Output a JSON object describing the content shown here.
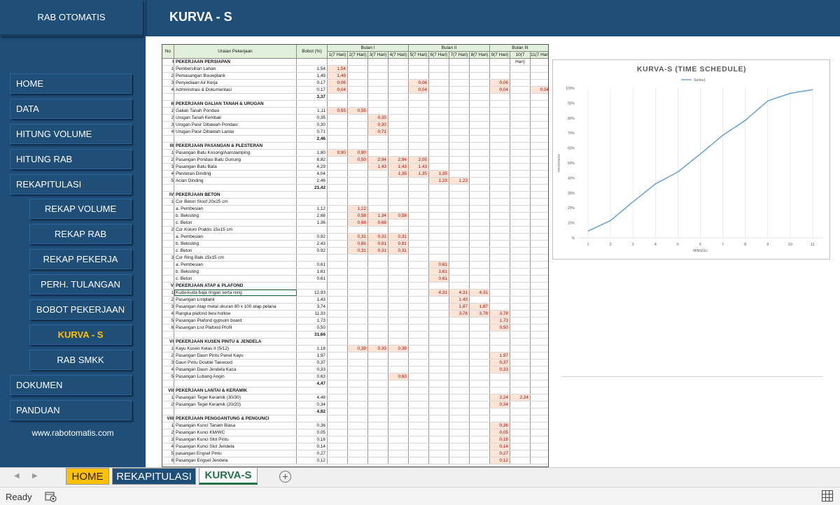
{
  "sidebar": {
    "title": "RAB OTOMATIS",
    "items": [
      {
        "label": "HOME",
        "sub": false,
        "active": false,
        "name": "nav-home"
      },
      {
        "label": "DATA",
        "sub": false,
        "active": false,
        "name": "nav-data"
      },
      {
        "label": "HITUNG VOLUME",
        "sub": false,
        "active": false,
        "name": "nav-hitung-volume"
      },
      {
        "label": "HITUNG RAB",
        "sub": false,
        "active": false,
        "name": "nav-hitung-rab"
      },
      {
        "label": "REKAPITULASI",
        "sub": false,
        "active": false,
        "name": "nav-rekapitulasi"
      },
      {
        "label": "REKAP VOLUME",
        "sub": true,
        "active": false,
        "name": "nav-rekap-volume"
      },
      {
        "label": "REKAP RAB",
        "sub": true,
        "active": false,
        "name": "nav-rekap-rab"
      },
      {
        "label": "REKAP PEKERJA",
        "sub": true,
        "active": false,
        "name": "nav-rekap-pekerja"
      },
      {
        "label": "PERH. TULANGAN",
        "sub": true,
        "active": false,
        "name": "nav-perh-tulangan"
      },
      {
        "label": "BOBOT PEKERJAAN",
        "sub": true,
        "active": false,
        "name": "nav-bobot-pekerjaan"
      },
      {
        "label": "KURVA - S",
        "sub": true,
        "active": true,
        "name": "nav-kurva-s"
      },
      {
        "label": "RAB SMKK",
        "sub": true,
        "active": false,
        "name": "nav-rab-smkk"
      },
      {
        "label": "DOKUMEN",
        "sub": false,
        "active": false,
        "name": "nav-dokumen"
      },
      {
        "label": "PANDUAN",
        "sub": false,
        "active": false,
        "name": "nav-panduan"
      }
    ],
    "website": "www.rabotomatis.com"
  },
  "header": {
    "title": "KURVA - S"
  },
  "table": {
    "headers": {
      "no": "No",
      "uraian": "Uraian Pekerjaan",
      "bobot": "Bobot (%)"
    },
    "months": [
      "Bulan I",
      "Bulan II",
      "Bulan III"
    ],
    "weeks": [
      "1(7 Hari)",
      "2(7 Hari)",
      "3(7 Hari)",
      "4(7 Hari)",
      "5(7 Hari)",
      "6(7 Hari)",
      "7(7 Hari)",
      "8(7 Hari)",
      "9(7 Hari)",
      "10(7 Hari)",
      "11(7 Hari)"
    ],
    "rows": [
      {
        "no": "I",
        "u": "PEKERJAAN PERSIAPAN",
        "b": "",
        "v": {},
        "t": "sec"
      },
      {
        "no": "1",
        "u": "Pembersihan Lahan",
        "b": "1,54",
        "v": {
          "0": "1,54"
        }
      },
      {
        "no": "2",
        "u": "Pemasangan Bouwplank",
        "b": "1,49",
        "v": {
          "0": "1,49"
        }
      },
      {
        "no": "3",
        "u": "Penyediaan Air Kerja",
        "b": "0,17",
        "v": {
          "0": "0,06",
          "4": "0,06",
          "8": "0,06"
        }
      },
      {
        "no": "4",
        "u": "Administrasi & Dokumentasi",
        "b": "0,17",
        "v": {
          "0": "0,04",
          "4": "0,04",
          "8": "0,04",
          "10": "0,04"
        }
      },
      {
        "no": "",
        "u": "",
        "b": "3,37",
        "v": {},
        "t": "tot"
      },
      {
        "no": "II",
        "u": "PEKERJAAN GALIAN TANAH & URUGAN",
        "b": "",
        "v": {},
        "t": "sec"
      },
      {
        "no": "1",
        "u": "Galian Tanah Pondasi",
        "b": "1,11",
        "v": {
          "0": "0,55",
          "1": "0,55"
        }
      },
      {
        "no": "2",
        "u": "Urugan Tanah Kembali",
        "b": "0,35",
        "v": {
          "2": "0,35"
        }
      },
      {
        "no": "3",
        "u": "Urugan Pasir Dibawah Pondasi",
        "b": "0,30",
        "v": {
          "2": "0,30"
        }
      },
      {
        "no": "4",
        "u": "Urugan Pasir Dibawah Lantai",
        "b": "0,71",
        "v": {
          "2": "0,71"
        }
      },
      {
        "no": "",
        "u": "",
        "b": "2,46",
        "v": {},
        "t": "tot"
      },
      {
        "no": "III",
        "u": "PEKERJAAN PASANGAN & PLESTERAN",
        "b": "",
        "v": {},
        "t": "sec"
      },
      {
        "no": "1",
        "u": "Pasangan Batu Kosong/Aanstamping",
        "b": "1,80",
        "v": {
          "0": "0,90",
          "1": "0,90"
        }
      },
      {
        "no": "2",
        "u": "Pasangan Pondasi Batu Gunung",
        "b": "8,82",
        "v": {
          "1": "0,50",
          "2": "2,94",
          "3": "2,94",
          "4": "2,05"
        }
      },
      {
        "no": "3",
        "u": "Pasangan Batu Bata",
        "b": "4,29",
        "v": {
          "2": "1,43",
          "3": "1,43",
          "4": "1,43"
        }
      },
      {
        "no": "4",
        "u": "Plesteran Dinding",
        "b": "4,04",
        "v": {
          "3": "1,35",
          "4": "1,35",
          "5": "1,35"
        }
      },
      {
        "no": "5",
        "u": "Acian Dinding",
        "b": "2,46",
        "v": {
          "5": "1,23",
          "6": "1,23"
        }
      },
      {
        "no": "",
        "u": "",
        "b": "21,42",
        "v": {},
        "t": "tot"
      },
      {
        "no": "IV",
        "u": "PEKERJAAN BETON",
        "b": "",
        "v": {},
        "t": "sec"
      },
      {
        "no": "1",
        "u": "Cor Beton Sloof 20x25 cm",
        "b": "",
        "v": {}
      },
      {
        "no": "",
        "u": "a. Pembesian",
        "b": "1,12",
        "v": {
          "1": "1,12"
        }
      },
      {
        "no": "",
        "u": "b. Bekisting",
        "b": "2,68",
        "v": {
          "1": "0,58",
          "2": "1,34",
          "3": "0,58"
        }
      },
      {
        "no": "",
        "u": "c. Beton",
        "b": "1,36",
        "v": {
          "1": "0,68",
          "2": "0,68"
        }
      },
      {
        "no": "2",
        "u": "Cor Kolom Praktis 15x15 cm",
        "b": "",
        "v": {}
      },
      {
        "no": "",
        "u": "a. Pembesian",
        "b": "0,92",
        "v": {
          "1": "0,31",
          "2": "0,31",
          "3": "0,31"
        }
      },
      {
        "no": "",
        "u": "b. Bekisting",
        "b": "2,43",
        "v": {
          "1": "0,81",
          "2": "0,81",
          "3": "0,81"
        }
      },
      {
        "no": "",
        "u": "c. Beton",
        "b": "0,92",
        "v": {
          "1": "0,31",
          "2": "0,31",
          "3": "0,31"
        }
      },
      {
        "no": "3",
        "u": "Cor Ring Balk 15x15 cm",
        "b": "",
        "v": {}
      },
      {
        "no": "",
        "u": "a. Pembesian",
        "b": "0,61",
        "v": {
          "5": "0,61"
        }
      },
      {
        "no": "",
        "u": "b. Bekisting",
        "b": "1,61",
        "v": {
          "5": "1,61"
        }
      },
      {
        "no": "",
        "u": "c. Beton",
        "b": "0,61",
        "v": {
          "5": "0,61"
        }
      },
      {
        "no": "V",
        "u": "PEKERJAAN ATAP & PLAFOND",
        "b": "",
        "v": {},
        "t": "sec"
      },
      {
        "no": "1",
        "u": "Kuda-kuda baja ringan serta reng",
        "b": "12,93",
        "v": {
          "5": "4,31",
          "6": "4,31",
          "7": "4,31"
        }
      },
      {
        "no": "2",
        "u": "Pasangan Listplank",
        "b": "1,43",
        "v": {
          "6": "1,43"
        }
      },
      {
        "no": "3",
        "u": "Pasangan Atap metal ukuran 80 x 100 atap pelana",
        "b": "3,74",
        "v": {
          "6": "1,87",
          "7": "1,87"
        }
      },
      {
        "no": "4",
        "u": "Rangka plafond besi hollow",
        "b": "11,33",
        "v": {
          "6": "3,78",
          "7": "3,78",
          "8": "3,78"
        }
      },
      {
        "no": "5",
        "u": "Pasangan Plafond gypsum board",
        "b": "1,73",
        "v": {
          "8": "1,73"
        }
      },
      {
        "no": "6",
        "u": "Pasangan List Plafond Profil",
        "b": "0,50",
        "v": {
          "8": "0,50"
        }
      },
      {
        "no": "",
        "u": "",
        "b": "31,66",
        "v": {},
        "t": "tot"
      },
      {
        "no": "VI",
        "u": "PEKERJAAN KUSEN PINTU & JENDELA",
        "b": "",
        "v": {},
        "t": "sec"
      },
      {
        "no": "1",
        "u": "Kayu Kusen Kelas II (5/12)",
        "b": "1,18",
        "v": {
          "1": "0,39",
          "2": "0,39",
          "3": "0,39"
        }
      },
      {
        "no": "2",
        "u": "Pasangan Daun Pintu Panel Kayu",
        "b": "1,97",
        "v": {
          "8": "1,97"
        }
      },
      {
        "no": "3",
        "u": "Daun Pintu Double Taewood",
        "b": "0,37",
        "v": {
          "8": "0,37"
        }
      },
      {
        "no": "4",
        "u": "Pasangan Daun Jendela Kaca",
        "b": "0,33",
        "v": {
          "8": "0,33"
        }
      },
      {
        "no": "5",
        "u": "Pasangan Lubang Angin",
        "b": "0,63",
        "v": {
          "3": "0,63"
        }
      },
      {
        "no": "",
        "u": "",
        "b": "4,47",
        "v": {},
        "t": "tot"
      },
      {
        "no": "VII",
        "u": "PEKERJAAN LANTAI & KERAMIK",
        "b": "",
        "v": {},
        "t": "sec"
      },
      {
        "no": "1",
        "u": "Pasangan Tegel Keramik (30/30)",
        "b": "4,48",
        "v": {
          "8": "2,24",
          "9": "2,24"
        }
      },
      {
        "no": "2",
        "u": "Pasangan Tegel Keramik (20/20)",
        "b": "0,34",
        "v": {
          "8": "0,34"
        }
      },
      {
        "no": "",
        "u": "",
        "b": "4,82",
        "v": {},
        "t": "tot"
      },
      {
        "no": "VIII",
        "u": "PEKERJAAN PENGGANTUNG & PENGUNCI",
        "b": "",
        "v": {},
        "t": "sec"
      },
      {
        "no": "1",
        "u": "Pasangan Kunci Tanam Biasa",
        "b": "0,36",
        "v": {
          "8": "0,36"
        }
      },
      {
        "no": "2",
        "u": "Pasangan Kunci KM/WC",
        "b": "0,05",
        "v": {
          "8": "0,05"
        }
      },
      {
        "no": "3",
        "u": "Pasangan Kunci Slot Pintu",
        "b": "0,18",
        "v": {
          "8": "0,18"
        }
      },
      {
        "no": "4",
        "u": "Pasangan Kunci Slot Jendela",
        "b": "0,14",
        "v": {
          "8": "0,14"
        }
      },
      {
        "no": "5",
        "u": "pasangan Engsel Pintu",
        "b": "0,27",
        "v": {
          "8": "0,27"
        }
      },
      {
        "no": "6",
        "u": "Pasangan Engsel Jendela",
        "b": "0,12",
        "v": {
          "8": "0,12"
        }
      }
    ]
  },
  "chart_data": {
    "type": "line",
    "title": "KURVA-S (TIME SCHEDULE)",
    "xlabel": "MINGGU",
    "ylabel": "PROGRESS",
    "x": [
      1,
      2,
      3,
      4,
      5,
      6,
      7,
      8,
      9,
      10,
      11
    ],
    "series": [
      {
        "name": "Series1",
        "values": [
          4.5,
          11.5,
          24,
          36,
          44,
          56,
          68.5,
          78.5,
          91.5,
          96.5,
          99
        ]
      }
    ],
    "ylim": [
      0,
      100
    ],
    "yticks": [
      "%",
      "10%",
      "20%",
      "30%",
      "40%",
      "50%",
      "60%",
      "70%",
      "80%",
      "90%",
      "100%"
    ],
    "legend": "top",
    "color": "#5b9bd5"
  },
  "sheet_tabs": [
    {
      "label": "HOME",
      "bg": "#ffc000",
      "fg": "#1f1f1f",
      "name": "sheet-tab-home"
    },
    {
      "label": "REKAPITULASI",
      "bg": "#1f4e79",
      "fg": "#ffffff",
      "name": "sheet-tab-rekapitulasi"
    },
    {
      "label": "KURVA-S",
      "bg": "#ffffff",
      "fg": "#217346",
      "name": "sheet-tab-kurva-s"
    }
  ],
  "status": {
    "ready": "Ready"
  }
}
